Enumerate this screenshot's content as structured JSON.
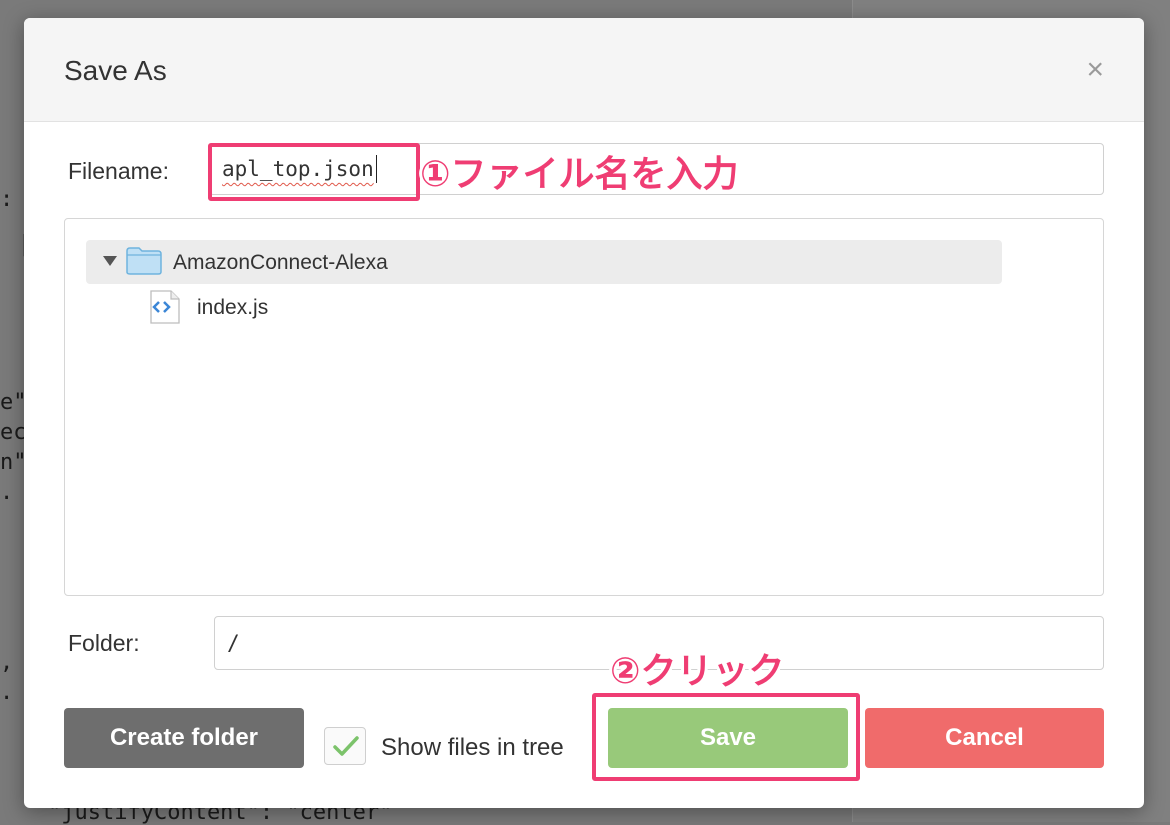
{
  "background": {
    "code_fragments": [
      "",
      ":",
      "",
      "e\":",
      "ect",
      "n\":",
      "",
      "",
      "",
      "",
      "",
      "",
      ",",
      "",
      ""
    ],
    "bottom_line": "\"justifyContent\": \"center\""
  },
  "dialog": {
    "title": "Save As",
    "close_symbol": "×",
    "filename_label": "Filename:",
    "filename_value": "apl_top.json",
    "folder_label": "Folder:",
    "folder_value": "/",
    "tree": {
      "folder_name": "AmazonConnect-Alexa",
      "file_name": "index.js"
    },
    "buttons": {
      "create_folder": "Create folder",
      "show_files_label": "Show files in tree",
      "save": "Save",
      "cancel": "Cancel"
    },
    "show_files_checked": true
  },
  "annotations": {
    "step1": "①ファイル名を入力",
    "step2": "②クリック"
  },
  "colors": {
    "save": "#98c97a",
    "cancel": "#f06b6b",
    "create_folder": "#6e6e6e",
    "highlight": "#ef3d73"
  }
}
